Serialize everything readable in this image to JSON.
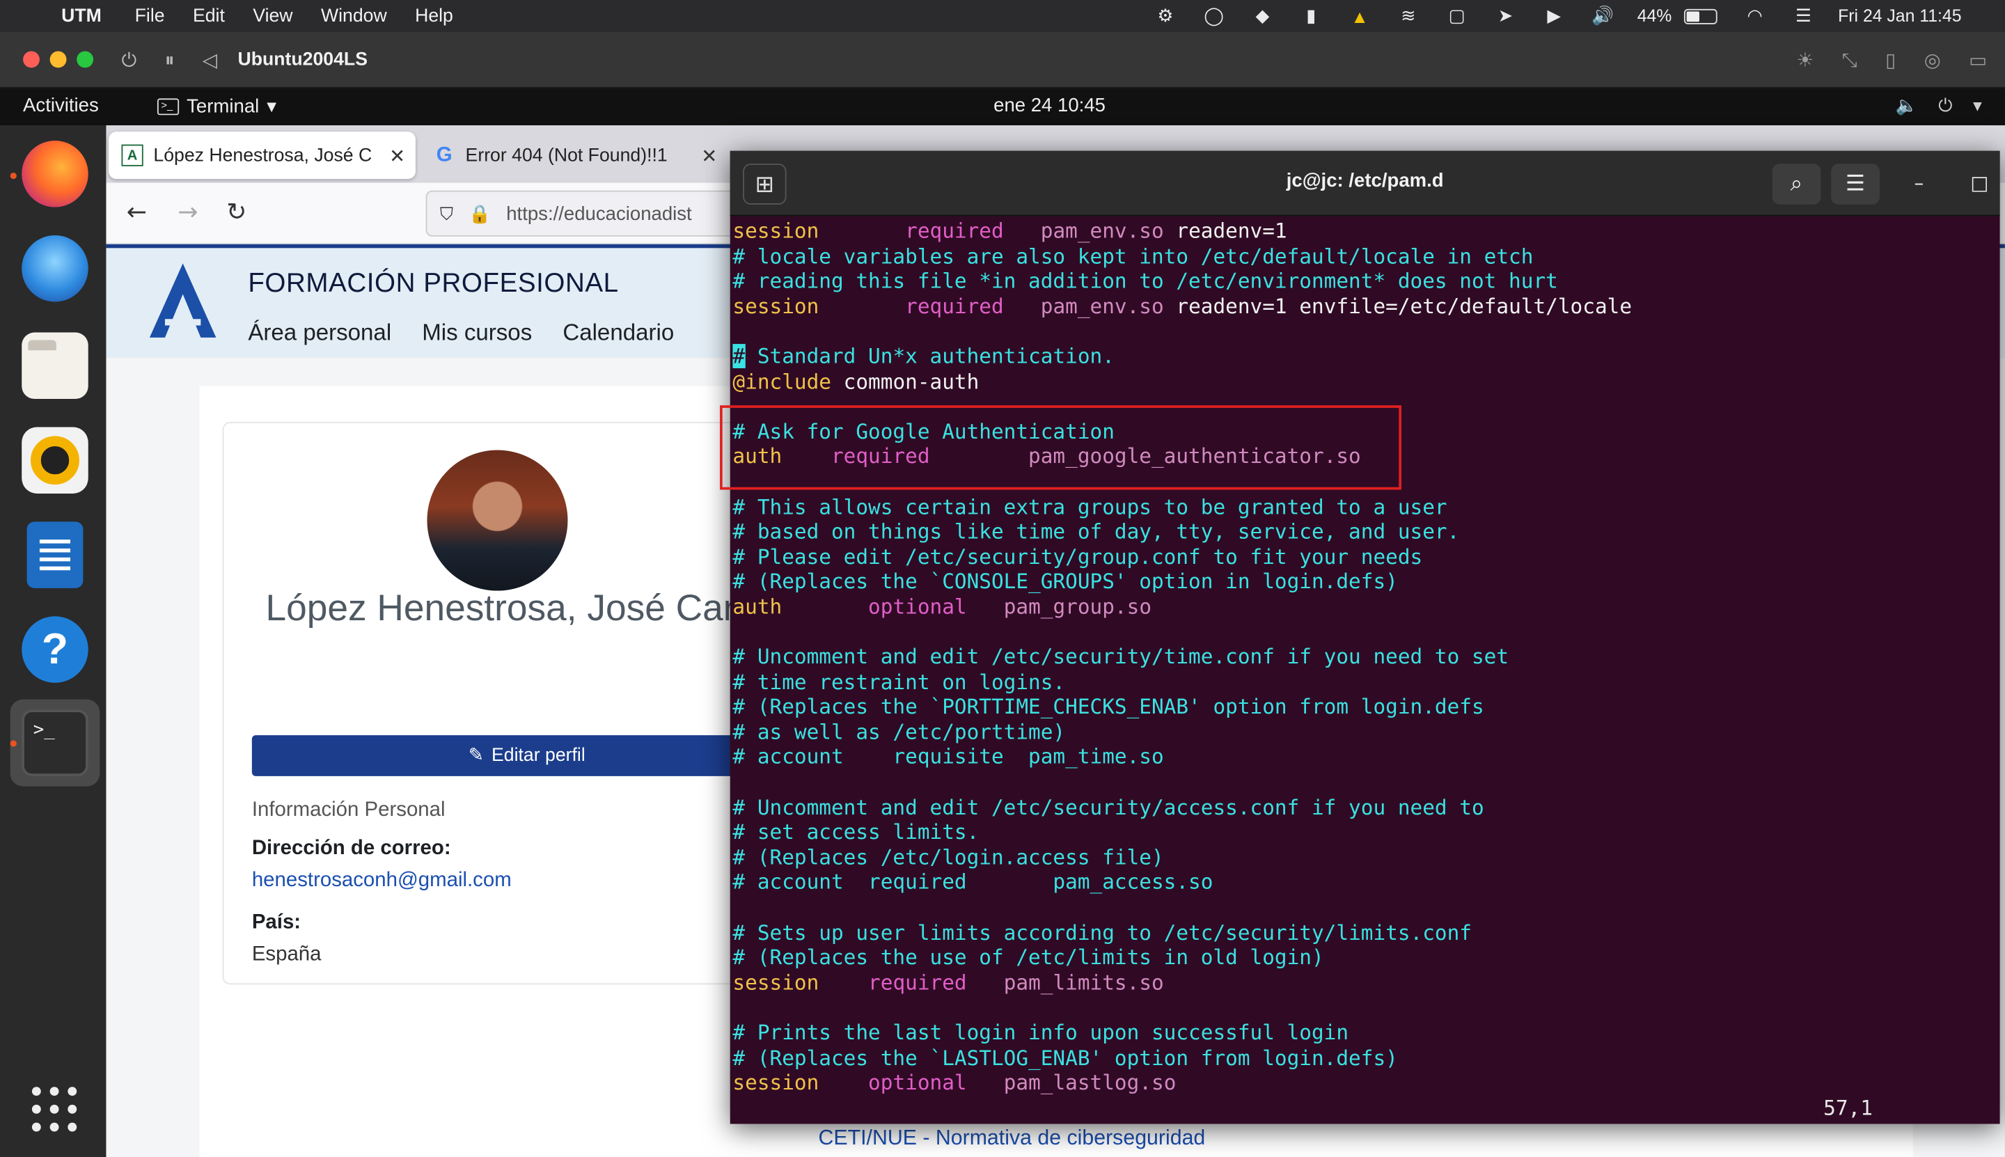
{
  "mac_menubar": {
    "app": "UTM",
    "menus": [
      "File",
      "Edit",
      "View",
      "Window",
      "Help"
    ],
    "battery_percent": "44%",
    "battery_level": 0.44,
    "datetime": "Fri 24 Jan  11:45"
  },
  "utm": {
    "vm_title": "Ubuntu2004LS"
  },
  "gnome": {
    "activities": "Activities",
    "app_name": "Terminal",
    "clock": "ene 24  10:45"
  },
  "firefox": {
    "tabs": [
      {
        "title": "López Henestrosa, José C",
        "favicon": "moodle-icon"
      },
      {
        "title": "Error 404 (Not Found)!!1",
        "favicon": "google-icon"
      }
    ],
    "url": "https://educacionadist"
  },
  "moodle": {
    "site_title": "FORMACIÓN PROFESIONAL",
    "nav": [
      "Área personal",
      "Mis cursos",
      "Calendario"
    ],
    "profile_name": "López Henestrosa, José Carlos",
    "edit_button": "Editar perfil",
    "section_heading": "Información Personal",
    "email_label": "Dirección de correo:",
    "email_value": "henestrosaconh@gmail.com",
    "country_label": "País:",
    "country_value": "España",
    "bottom_link": "CETI/NUE - Normativa de ciberseguridad"
  },
  "terminal": {
    "title": "jc@jc: /etc/pam.d",
    "cursor_position": "57,1",
    "lines": [
      [
        [
          "session       ",
          "c-kw"
        ],
        [
          "required   ",
          "c-req"
        ],
        [
          "pam_env.so ",
          "c-mod"
        ],
        [
          "readenv=1",
          "c-plain"
        ]
      ],
      [
        [
          "# locale variables are also kept into /etc/default/locale in etch",
          "c-cmt"
        ]
      ],
      [
        [
          "# reading this file *in addition to /etc/environment* does not hurt",
          "c-cmt"
        ]
      ],
      [
        [
          "session       ",
          "c-kw"
        ],
        [
          "required   ",
          "c-req"
        ],
        [
          "pam_env.so ",
          "c-mod"
        ],
        [
          "readenv=1 envfile=/etc/default/locale",
          "c-plain"
        ]
      ],
      [],
      [
        [
          "#",
          "cursor"
        ],
        [
          " Standard Un*x authentication.",
          "c-cmt"
        ]
      ],
      [
        [
          "@include ",
          "c-kw"
        ],
        [
          "common-auth",
          "c-plain"
        ]
      ],
      [],
      [
        [
          "# Ask for Google Authentication",
          "c-cmt"
        ]
      ],
      [
        [
          "auth    ",
          "c-kw"
        ],
        [
          "required        ",
          "c-req"
        ],
        [
          "pam_google_authenticator.so",
          "c-mod"
        ]
      ],
      [],
      [
        [
          "# This allows certain extra groups to be granted to a user",
          "c-cmt"
        ]
      ],
      [
        [
          "# based on things like time of day, tty, service, and user.",
          "c-cmt"
        ]
      ],
      [
        [
          "# Please edit /etc/security/group.conf to fit your needs",
          "c-cmt"
        ]
      ],
      [
        [
          "# (Replaces the `CONSOLE_GROUPS' option in login.defs)",
          "c-cmt"
        ]
      ],
      [
        [
          "auth       ",
          "c-kw"
        ],
        [
          "optional   ",
          "c-req"
        ],
        [
          "pam_group.so",
          "c-mod"
        ]
      ],
      [],
      [
        [
          "# Uncomment and edit /etc/security/time.conf if you need to set",
          "c-cmt"
        ]
      ],
      [
        [
          "# time restraint on logins.",
          "c-cmt"
        ]
      ],
      [
        [
          "# (Replaces the `PORTTIME_CHECKS_ENAB' option from login.defs",
          "c-cmt"
        ]
      ],
      [
        [
          "# as well as /etc/porttime)",
          "c-cmt"
        ]
      ],
      [
        [
          "# account    requisite  pam_time.so",
          "c-cmt"
        ]
      ],
      [],
      [
        [
          "# Uncomment and edit /etc/security/access.conf if you need to",
          "c-cmt"
        ]
      ],
      [
        [
          "# set access limits.",
          "c-cmt"
        ]
      ],
      [
        [
          "# (Replaces /etc/login.access file)",
          "c-cmt"
        ]
      ],
      [
        [
          "# account  required       pam_access.so",
          "c-cmt"
        ]
      ],
      [],
      [
        [
          "# Sets up user limits according to /etc/security/limits.conf",
          "c-cmt"
        ]
      ],
      [
        [
          "# (Replaces the use of /etc/limits in old login)",
          "c-cmt"
        ]
      ],
      [
        [
          "session    ",
          "c-kw"
        ],
        [
          "required   ",
          "c-req"
        ],
        [
          "pam_limits.so",
          "c-mod"
        ]
      ],
      [],
      [
        [
          "# Prints the last login info upon successful login",
          "c-cmt"
        ]
      ],
      [
        [
          "# (Replaces the `LASTLOG_ENAB' option from login.defs)",
          "c-cmt"
        ]
      ],
      [
        [
          "session    ",
          "c-kw"
        ],
        [
          "optional   ",
          "c-req"
        ],
        [
          "pam_lastlog.so",
          "c-mod"
        ]
      ]
    ]
  },
  "colors": {
    "terminal_bg": "#300a24",
    "comment": "#3ae2e2",
    "keyword": "#f0c24a",
    "highlight_box": "#e02020",
    "moodle_blue": "#1b3d8c"
  }
}
